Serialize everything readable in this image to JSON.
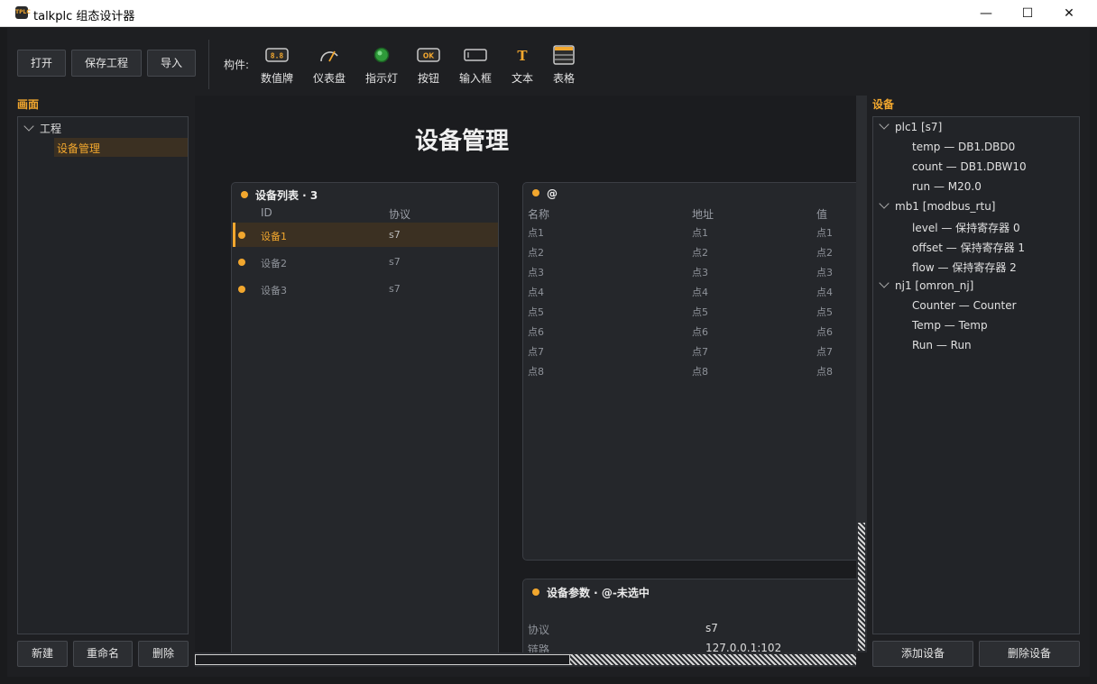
{
  "window": {
    "app_icon": "TalkPLC",
    "title": "talkplc 组态设计器",
    "minimize": "—",
    "maximize": "☐",
    "close": "✕"
  },
  "toolbar": {
    "open": "打开",
    "save_project": "保存工程",
    "import": "导入",
    "components_label": "构件:",
    "tools": [
      {
        "label": "数值牌",
        "icon": "numeric-display-icon"
      },
      {
        "label": "仪表盘",
        "icon": "gauge-icon"
      },
      {
        "label": "指示灯",
        "icon": "indicator-light-icon"
      },
      {
        "label": "按钮",
        "icon": "ok-button-icon"
      },
      {
        "label": "输入框",
        "icon": "input-box-icon"
      },
      {
        "label": "文本",
        "icon": "text-icon"
      },
      {
        "label": "表格",
        "icon": "table-icon"
      }
    ]
  },
  "screens_panel": {
    "title": "画面",
    "tree": {
      "root": "工程",
      "children": [
        "设备管理"
      ],
      "selected": "设备管理"
    },
    "buttons": {
      "new": "新建",
      "rename": "重命名",
      "delete": "删除"
    }
  },
  "canvas": {
    "page_title": "设备管理",
    "device_list": {
      "title": "设备列表 · 3",
      "headers": [
        "ID",
        "协议"
      ],
      "rows": [
        {
          "id": "设备1",
          "protocol": "s7",
          "selected": true
        },
        {
          "id": "设备2",
          "protocol": "s7",
          "selected": false
        },
        {
          "id": "设备3",
          "protocol": "s7",
          "selected": false
        }
      ]
    },
    "points": {
      "title": "@",
      "headers": [
        "名称",
        "地址",
        "值"
      ],
      "rows": [
        [
          "点1",
          "点1",
          "点1"
        ],
        [
          "点2",
          "点2",
          "点2"
        ],
        [
          "点3",
          "点3",
          "点3"
        ],
        [
          "点4",
          "点4",
          "点4"
        ],
        [
          "点5",
          "点5",
          "点5"
        ],
        [
          "点6",
          "点6",
          "点6"
        ],
        [
          "点7",
          "点7",
          "点7"
        ],
        [
          "点8",
          "点8",
          "点8"
        ]
      ]
    },
    "params": {
      "title": "设备参数 · @-未选中",
      "rows": [
        [
          "协议",
          "s7"
        ],
        [
          "链路",
          "127.0.0.1:102"
        ]
      ]
    }
  },
  "devices_panel": {
    "title": "设备",
    "tree": [
      {
        "label": "plc1  [s7]",
        "children": [
          "temp — DB1.DBD0",
          "count — DB1.DBW10",
          "run — M20.0"
        ]
      },
      {
        "label": "mb1  [modbus_rtu]",
        "children": [
          "level — 保持寄存器 0",
          "offset — 保持寄存器 1",
          "flow — 保持寄存器 2"
        ]
      },
      {
        "label": "nj1  [omron_nj]",
        "children": [
          "Counter — Counter",
          "Temp — Temp",
          "Run — Run"
        ]
      }
    ],
    "buttons": {
      "add": "添加设备",
      "delete": "删除设备"
    }
  },
  "colors": {
    "accent": "#f2a72e",
    "background": "#1e1f22",
    "panel": "#222428",
    "card": "#25272b"
  }
}
